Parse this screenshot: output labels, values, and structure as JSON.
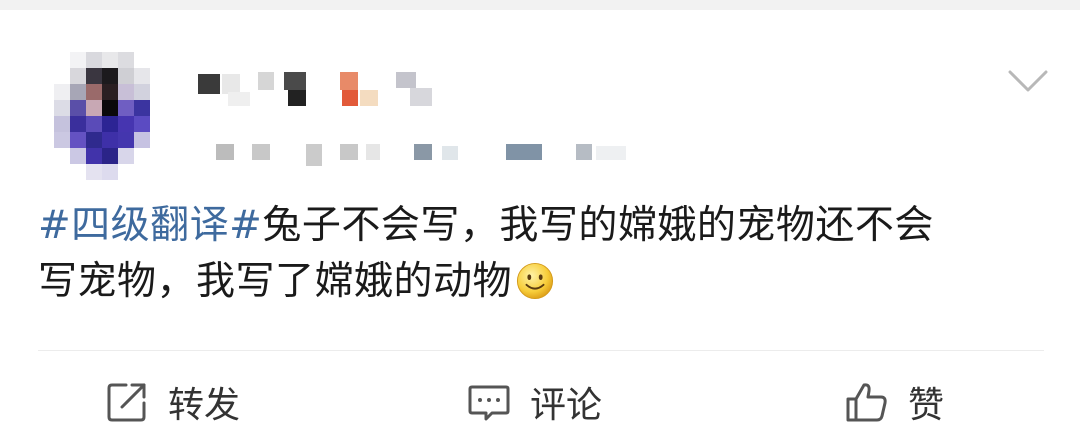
{
  "post": {
    "hashtag": "#四级翻译#",
    "body_line1": "兔子不会写，我写的嫦娥的宠物还不会",
    "body_line2": "写宠物，我写了嫦娥的动物",
    "emoji": "smile-emoji"
  },
  "header": {
    "menu_icon": "chevron-down-icon"
  },
  "actions": {
    "share_label": "转发",
    "comment_label": "评论",
    "like_label": "赞"
  },
  "colors": {
    "hashtag": "#3e6a9e",
    "text": "#1a1a1a",
    "action_text": "#333333",
    "divider": "#ececec"
  }
}
